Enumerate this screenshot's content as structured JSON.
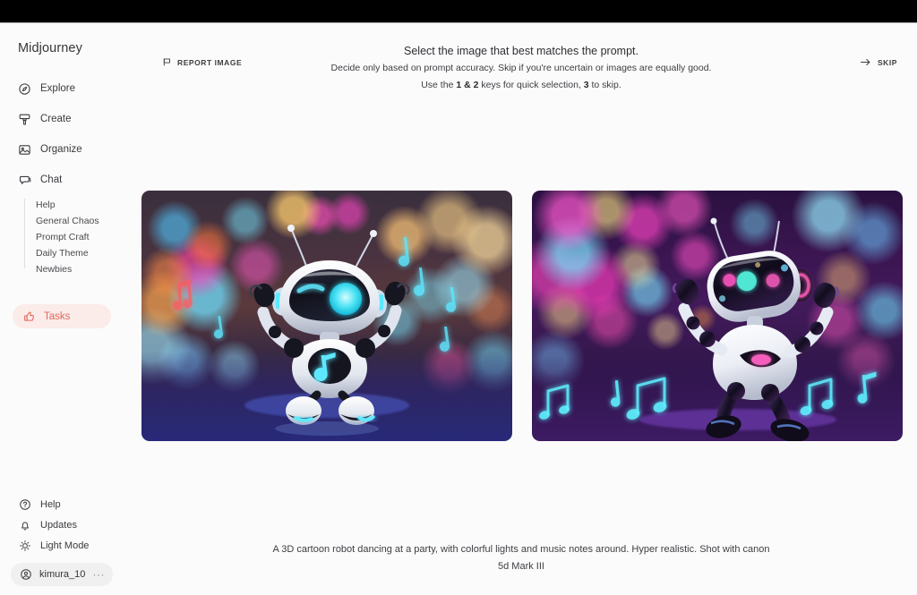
{
  "brand": "Midjourney",
  "sidebar": {
    "nav": [
      {
        "label": "Explore",
        "icon": "compass-icon"
      },
      {
        "label": "Create",
        "icon": "brush-icon"
      },
      {
        "label": "Organize",
        "icon": "image-icon"
      },
      {
        "label": "Chat",
        "icon": "chat-bubble-icon"
      }
    ],
    "chat_children": [
      {
        "label": "Help"
      },
      {
        "label": "General Chaos"
      },
      {
        "label": "Prompt Craft"
      },
      {
        "label": "Daily Theme"
      },
      {
        "label": "Newbies"
      }
    ],
    "tasks": {
      "label": "Tasks",
      "icon": "thumbs-up-icon",
      "active": true
    },
    "bottom_nav": [
      {
        "label": "Help",
        "icon": "question-circle-icon"
      },
      {
        "label": "Updates",
        "icon": "bell-icon"
      },
      {
        "label": "Light Mode",
        "icon": "sun-icon"
      }
    ],
    "user": {
      "name": "kimura_10",
      "icon": "user-circle-icon",
      "menu": "···"
    }
  },
  "header": {
    "report_button": {
      "label": "REPORT IMAGE",
      "icon": "flag-icon"
    },
    "skip_button": {
      "label": "SKIP",
      "icon": "arrow-right-icon"
    },
    "title": "Select the image that best matches the prompt.",
    "subtitle": "Decide only based on prompt accuracy. Skip if you're uncertain or images are equally good.",
    "hint_prefix": "Use the ",
    "hint_keys_1": "1 & 2",
    "hint_middle": " keys for quick selection, ",
    "hint_keys_2": "3",
    "hint_suffix": " to skip."
  },
  "images": [
    {
      "position": 1,
      "alt": "3D cartoon white robot with cyan glowing face dancing with arms raised, warm orange and cyan bokeh party lights, cyan music notes, reflective floor"
    },
    {
      "position": 2,
      "alt": "3D cartoon white robot with dark glossy visor dancing mid-air, purple and magenta bokeh lights, cyan music notes on reflective floor"
    }
  ],
  "prompt": "A 3D cartoon robot dancing at a party, with colorful lights and music notes around. Hyper realistic. Shot with canon 5d Mark III",
  "colors": {
    "accent": "#e0695c",
    "accent_bg": "#fbebe9",
    "page_bg": "#fbfbfb",
    "text": "#3d3e42",
    "topbar": "#000000"
  }
}
